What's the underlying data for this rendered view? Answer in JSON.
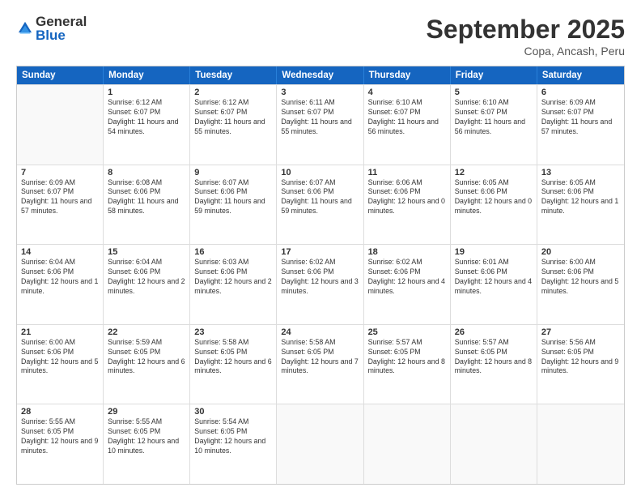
{
  "logo": {
    "general": "General",
    "blue": "Blue"
  },
  "title": "September 2025",
  "location": "Copa, Ancash, Peru",
  "days": [
    "Sunday",
    "Monday",
    "Tuesday",
    "Wednesday",
    "Thursday",
    "Friday",
    "Saturday"
  ],
  "weeks": [
    [
      {
        "day": "",
        "empty": true
      },
      {
        "day": "1",
        "sunrise": "6:12 AM",
        "sunset": "6:07 PM",
        "daylight": "11 hours and 54 minutes."
      },
      {
        "day": "2",
        "sunrise": "6:12 AM",
        "sunset": "6:07 PM",
        "daylight": "11 hours and 55 minutes."
      },
      {
        "day": "3",
        "sunrise": "6:11 AM",
        "sunset": "6:07 PM",
        "daylight": "11 hours and 55 minutes."
      },
      {
        "day": "4",
        "sunrise": "6:10 AM",
        "sunset": "6:07 PM",
        "daylight": "11 hours and 56 minutes."
      },
      {
        "day": "5",
        "sunrise": "6:10 AM",
        "sunset": "6:07 PM",
        "daylight": "11 hours and 56 minutes."
      },
      {
        "day": "6",
        "sunrise": "6:09 AM",
        "sunset": "6:07 PM",
        "daylight": "11 hours and 57 minutes."
      }
    ],
    [
      {
        "day": "7",
        "sunrise": "6:09 AM",
        "sunset": "6:07 PM",
        "daylight": "11 hours and 57 minutes."
      },
      {
        "day": "8",
        "sunrise": "6:08 AM",
        "sunset": "6:06 PM",
        "daylight": "11 hours and 58 minutes."
      },
      {
        "day": "9",
        "sunrise": "6:07 AM",
        "sunset": "6:06 PM",
        "daylight": "11 hours and 59 minutes."
      },
      {
        "day": "10",
        "sunrise": "6:07 AM",
        "sunset": "6:06 PM",
        "daylight": "11 hours and 59 minutes."
      },
      {
        "day": "11",
        "sunrise": "6:06 AM",
        "sunset": "6:06 PM",
        "daylight": "12 hours and 0 minutes."
      },
      {
        "day": "12",
        "sunrise": "6:05 AM",
        "sunset": "6:06 PM",
        "daylight": "12 hours and 0 minutes."
      },
      {
        "day": "13",
        "sunrise": "6:05 AM",
        "sunset": "6:06 PM",
        "daylight": "12 hours and 1 minute."
      }
    ],
    [
      {
        "day": "14",
        "sunrise": "6:04 AM",
        "sunset": "6:06 PM",
        "daylight": "12 hours and 1 minute."
      },
      {
        "day": "15",
        "sunrise": "6:04 AM",
        "sunset": "6:06 PM",
        "daylight": "12 hours and 2 minutes."
      },
      {
        "day": "16",
        "sunrise": "6:03 AM",
        "sunset": "6:06 PM",
        "daylight": "12 hours and 2 minutes."
      },
      {
        "day": "17",
        "sunrise": "6:02 AM",
        "sunset": "6:06 PM",
        "daylight": "12 hours and 3 minutes."
      },
      {
        "day": "18",
        "sunrise": "6:02 AM",
        "sunset": "6:06 PM",
        "daylight": "12 hours and 4 minutes."
      },
      {
        "day": "19",
        "sunrise": "6:01 AM",
        "sunset": "6:06 PM",
        "daylight": "12 hours and 4 minutes."
      },
      {
        "day": "20",
        "sunrise": "6:00 AM",
        "sunset": "6:06 PM",
        "daylight": "12 hours and 5 minutes."
      }
    ],
    [
      {
        "day": "21",
        "sunrise": "6:00 AM",
        "sunset": "6:06 PM",
        "daylight": "12 hours and 5 minutes."
      },
      {
        "day": "22",
        "sunrise": "5:59 AM",
        "sunset": "6:05 PM",
        "daylight": "12 hours and 6 minutes."
      },
      {
        "day": "23",
        "sunrise": "5:58 AM",
        "sunset": "6:05 PM",
        "daylight": "12 hours and 6 minutes."
      },
      {
        "day": "24",
        "sunrise": "5:58 AM",
        "sunset": "6:05 PM",
        "daylight": "12 hours and 7 minutes."
      },
      {
        "day": "25",
        "sunrise": "5:57 AM",
        "sunset": "6:05 PM",
        "daylight": "12 hours and 8 minutes."
      },
      {
        "day": "26",
        "sunrise": "5:57 AM",
        "sunset": "6:05 PM",
        "daylight": "12 hours and 8 minutes."
      },
      {
        "day": "27",
        "sunrise": "5:56 AM",
        "sunset": "6:05 PM",
        "daylight": "12 hours and 9 minutes."
      }
    ],
    [
      {
        "day": "28",
        "sunrise": "5:55 AM",
        "sunset": "6:05 PM",
        "daylight": "12 hours and 9 minutes."
      },
      {
        "day": "29",
        "sunrise": "5:55 AM",
        "sunset": "6:05 PM",
        "daylight": "12 hours and 10 minutes."
      },
      {
        "day": "30",
        "sunrise": "5:54 AM",
        "sunset": "6:05 PM",
        "daylight": "12 hours and 10 minutes."
      },
      {
        "day": "",
        "empty": true
      },
      {
        "day": "",
        "empty": true
      },
      {
        "day": "",
        "empty": true
      },
      {
        "day": "",
        "empty": true
      }
    ]
  ]
}
